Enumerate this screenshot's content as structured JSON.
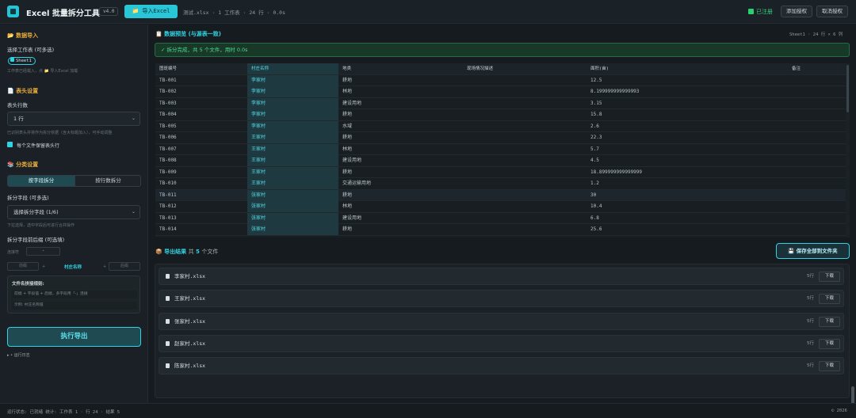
{
  "header": {
    "title": "Excel 批量拆分工具",
    "version": "v4.0",
    "import_label": "📁 导入Excel",
    "file_info": "测试.xlsx · 1 工作表 · 24 行 · 0.0s",
    "registered": "已注册",
    "add_license": "添加授权",
    "cancel_license": "取消授权"
  },
  "sidebar": {
    "import_section": {
      "icon": "📂",
      "title": "数据导入"
    },
    "sheet_label": "选择工作表 (可多选)",
    "sheet_chip": "Sheet1",
    "sheet_hint": "工作表已经载入，点 📁 导入Excel 加载",
    "header_section": {
      "icon": "📄",
      "title": "表头设置"
    },
    "header_rows_label": "表头行数",
    "header_rows_value": "1 行",
    "header_rows_hint": "已识别表头并将作为拆分依据（含大标题加入），可手动调整",
    "keep_header_label": "每个文件保留表头行",
    "split_section": {
      "icon": "📚",
      "title": "分类设置"
    },
    "tab_by_field": "按字段拆分",
    "tab_by_rows": "按行数拆分",
    "split_field_label": "拆分字段 (可多选)",
    "split_field_value": "选择拆分字段 (1/6)",
    "split_field_hint": "下拉选择，选中字段后可进行合并操作",
    "affix_label": "拆分字段前后缀 (可选填)",
    "connector_label": "连接符",
    "connector_value": "-",
    "prefix_placeholder": "前缀",
    "field_name": "村庄名称",
    "suffix_placeholder": "后缀",
    "plus1": "+",
    "plus2": "+",
    "rule_title": "文件名拼接规则:",
    "rule_desc": "前缀 + 字段值 + 后缀，多字段用「-」连接",
    "rule_example": "示例: 村庄名称值",
    "run_label": "执行导出",
    "run_log": "▸ • 运行日志"
  },
  "preview": {
    "title_icon": "📋",
    "title": "数据预览 (与源表一致)",
    "meta": "Sheet1 · 24 行 × 6 列",
    "banner": "✓ 拆分完成，共 5 个文件，用时 0.0s",
    "columns": [
      "图斑编号",
      "村庄名称",
      "地类",
      "现场情况描述",
      "面积(亩)",
      "备注"
    ],
    "rows": [
      [
        "TB-001",
        "李家村",
        "耕地",
        "",
        "12.5",
        ""
      ],
      [
        "TB-002",
        "李家村",
        "林地",
        "",
        "8.199999999999993",
        ""
      ],
      [
        "TB-003",
        "李家村",
        "建设用地",
        "",
        "3.15",
        ""
      ],
      [
        "TB-004",
        "李家村",
        "耕地",
        "",
        "15.8",
        ""
      ],
      [
        "TB-005",
        "李家村",
        "水域",
        "",
        "2.6",
        ""
      ],
      [
        "TB-006",
        "王家村",
        "耕地",
        "",
        "22.3",
        ""
      ],
      [
        "TB-007",
        "王家村",
        "林地",
        "",
        "5.7",
        ""
      ],
      [
        "TB-008",
        "王家村",
        "建设用地",
        "",
        "4.5",
        ""
      ],
      [
        "TB-009",
        "王家村",
        "耕地",
        "",
        "18.899999999999999",
        ""
      ],
      [
        "TB-010",
        "王家村",
        "交通运输用地",
        "",
        "1.2",
        ""
      ],
      [
        "TB-011",
        "张家村",
        "耕地",
        "",
        "30",
        ""
      ],
      [
        "TB-012",
        "张家村",
        "林地",
        "",
        "10.4",
        ""
      ],
      [
        "TB-013",
        "张家村",
        "建设用地",
        "",
        "6.8",
        ""
      ],
      [
        "TB-014",
        "张家村",
        "耕地",
        "",
        "25.6",
        ""
      ]
    ]
  },
  "results": {
    "title_icon": "📦",
    "title": "导出结果",
    "count_prefix": "共",
    "count": "5",
    "count_suffix": "个文件",
    "save_all": "💾 保存全部到文件夹",
    "files": [
      {
        "name": "李家村.xlsx",
        "rows": "5行",
        "download": "下载"
      },
      {
        "name": "王家村.xlsx",
        "rows": "5行",
        "download": "下载"
      },
      {
        "name": "张家村.xlsx",
        "rows": "5行",
        "download": "下载"
      },
      {
        "name": "赵家村.xlsx",
        "rows": "5行",
        "download": "下载"
      },
      {
        "name": "陈家村.xlsx",
        "rows": "5行",
        "download": "下载"
      }
    ]
  },
  "statusbar": {
    "left": "运行状态: 已就绪    统计: 工作表 1 · 行 24 · 结果 5",
    "right": "© 2026"
  },
  "colors": {
    "accent": "#2fd3e4",
    "success": "#37d07a",
    "warning": "#e6a93a",
    "background": "#161b1f"
  }
}
